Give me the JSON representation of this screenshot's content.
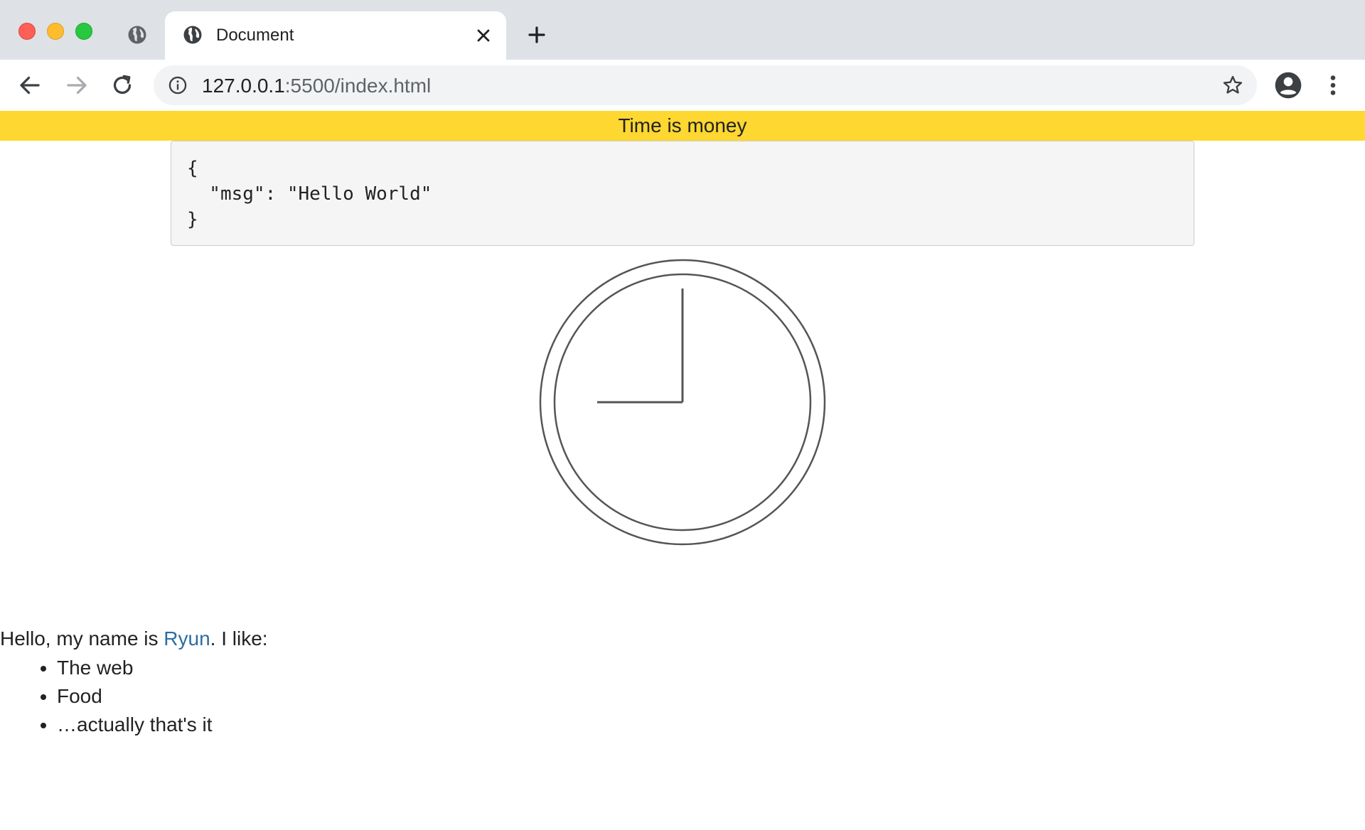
{
  "browser": {
    "tab": {
      "title": "Document"
    },
    "address_bar": {
      "host": "127.0.0.1",
      "path": ":5500/index.html"
    },
    "icons": {
      "inactive_tab": "globe-icon",
      "active_tab": "globe-icon",
      "close": "close-icon",
      "new_tab": "plus-icon",
      "back": "arrow-left-icon",
      "forward": "arrow-right-icon",
      "reload": "reload-icon",
      "site_info": "info-icon",
      "bookmark": "star-icon",
      "account": "account-icon",
      "menu": "kebab-menu-icon"
    }
  },
  "page": {
    "banner": "Time is money",
    "code": "{\n  \"msg\": \"Hello World\"\n}",
    "clock": {
      "hour": 9,
      "minute": 0
    },
    "intro": {
      "before": "Hello, my name is ",
      "link": "Ryun",
      "after": ". I like:"
    },
    "likes": [
      "The web",
      "Food",
      "…actually that's it"
    ]
  },
  "colors": {
    "banner": "#fed730",
    "link": "#2d6da3",
    "tabbar": "#dee1e6"
  }
}
